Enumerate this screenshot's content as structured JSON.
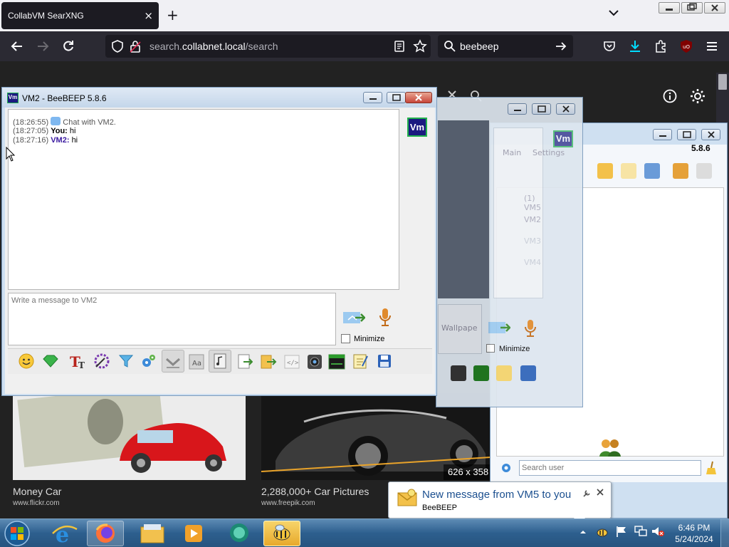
{
  "browser": {
    "tab_title": "CollabVM SearXNG",
    "url_prefix": "search.",
    "url_domain": "collabnet.local",
    "url_path": "/search",
    "search_value": "beebeep",
    "new_tab_symbol": "+",
    "tab_close_symbol": "×"
  },
  "results": [
    {
      "title": "Money Car",
      "source": "www.flickr.com"
    },
    {
      "title": "2,288,000+ Car Pictures",
      "source": "www.freepik.com",
      "dimensions": "626 x 358"
    }
  ],
  "chat_window": {
    "title": "VM2 - BeeBEEP 5.8.6",
    "avatar_label": "Vm",
    "messages": [
      {
        "time": "(18:26:55)",
        "sender": "",
        "text": "Chat with VM2."
      },
      {
        "time": "(18:27:05)",
        "sender": "You:",
        "text": "hi"
      },
      {
        "time": "(18:27:16)",
        "sender": "VM2:",
        "text": "hi"
      }
    ],
    "input_placeholder": "Write a message to VM2",
    "minimize_label": "Minimize"
  },
  "middle_window": {
    "avatar_label": "Vm",
    "tabs": [
      "Main",
      "Settings"
    ],
    "list": [
      "(1) VM5",
      "VM2",
      "VM3",
      "VM4"
    ],
    "wallpaper_label": "Wallpape",
    "minimize_label": "Minimize"
  },
  "main_window": {
    "version": "5.8.6",
    "search_placeholder": "Search user"
  },
  "notification": {
    "message": "New message from VM5 to you",
    "app": "BeeBEEP"
  },
  "taskbar": {
    "time": "6:46 PM",
    "date": "5/24/2024"
  },
  "colors": {
    "firefox_dark": "#1c1b22",
    "beebeep_frame": "#cfe0f1",
    "vm_badge_bg": "#1b1a80",
    "vm_badge_border": "#23b14d",
    "sender_vm2": "#3a1aa0"
  }
}
